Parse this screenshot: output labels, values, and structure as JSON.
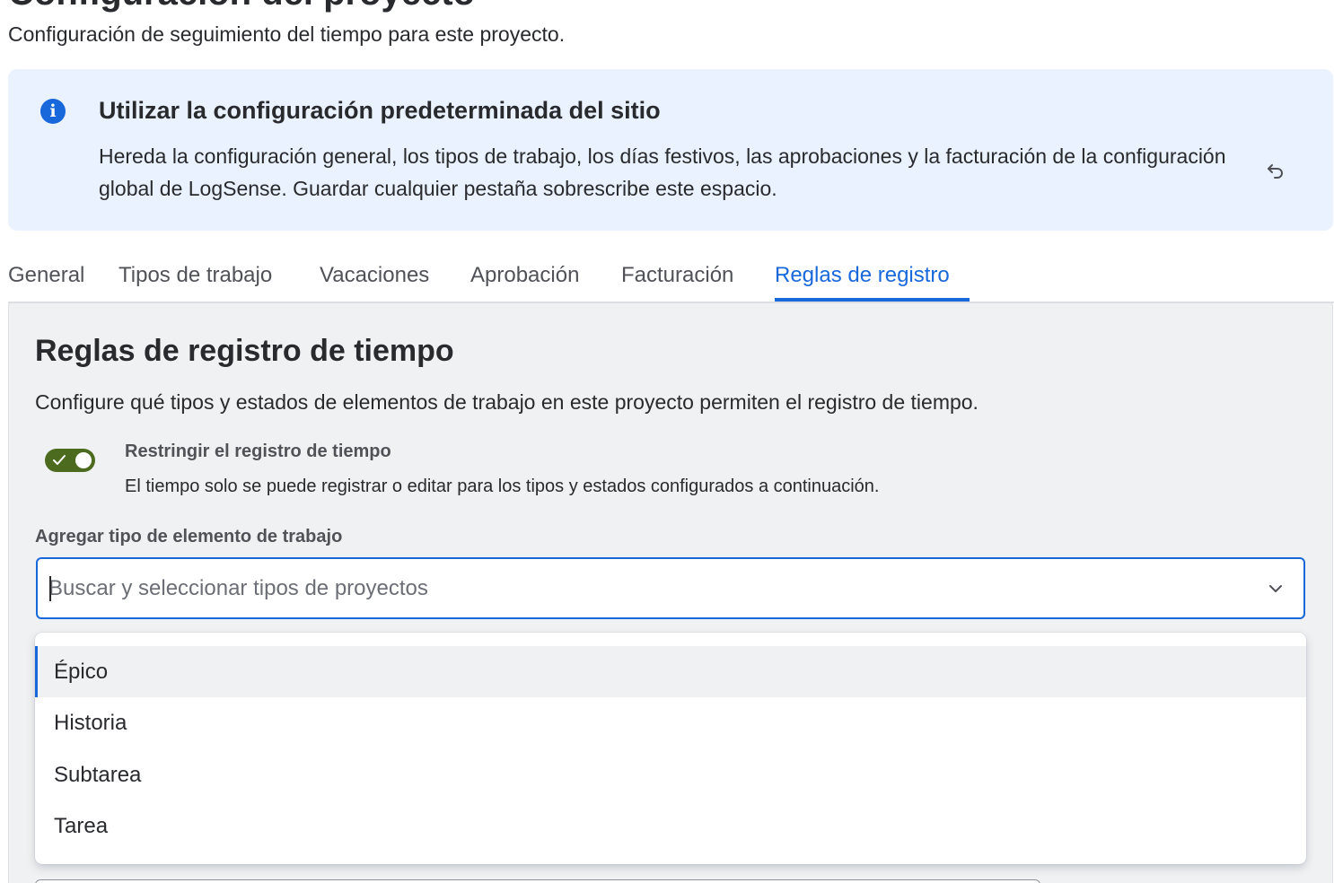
{
  "header": {
    "title": "Configuración del proyecto",
    "subtitle": "Configuración de seguimiento del tiempo para este proyecto."
  },
  "banner": {
    "icon": "info-icon",
    "title": "Utilizar la configuración predeterminada del sitio",
    "description": "Hereda la configuración general, los tipos de trabajo, los días festivos, las aprobaciones y la facturación de la configuración global de LogSense. Guardar cualquier pestaña sobrescribe este espacio.",
    "reset_icon": "undo-icon"
  },
  "tabs": [
    {
      "label": "General",
      "active": false
    },
    {
      "label": "Tipos de trabajo",
      "active": false
    },
    {
      "label": "Vacaciones",
      "active": false
    },
    {
      "label": "Aprobación",
      "active": false
    },
    {
      "label": "Facturación",
      "active": false
    },
    {
      "label": "Reglas de registro",
      "active": true
    }
  ],
  "section": {
    "title": "Reglas de registro de tiempo",
    "description": "Configure qué tipos y estados de elementos de trabajo en este proyecto permiten el registro de tiempo.",
    "toggle": {
      "label": "Restringir el registro de tiempo",
      "description": "El tiempo solo se puede registrar o editar para los tipos y estados configurados a continuación.",
      "checked": true
    },
    "select": {
      "label": "Agregar tipo de elemento de trabajo",
      "value": "",
      "placeholder": "Buscar y seleccionar tipos de proyectos",
      "options": [
        "Épico",
        "Historia",
        "Subtarea",
        "Tarea"
      ],
      "highlighted_index": 0
    }
  },
  "colors": {
    "accent": "#1868db",
    "banner_bg": "#e9f2fe",
    "toggle_on": "#4c6b1f",
    "panel_bg": "#f0f1f2"
  }
}
